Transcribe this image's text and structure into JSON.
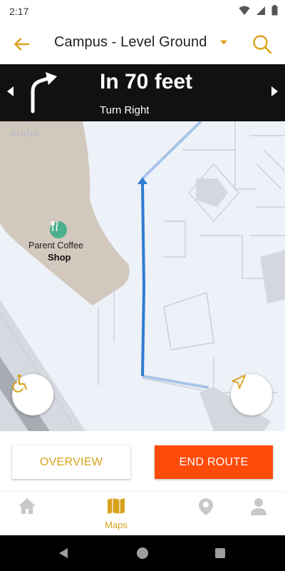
{
  "status_bar": {
    "time": "2:17"
  },
  "app_bar": {
    "title": "Campus - Level Ground"
  },
  "navigation": {
    "distance": "In 70 feet",
    "instruction": "Turn Right"
  },
  "map": {
    "logo_text": "aruba",
    "poi": {
      "name_line1": "Parent Coffee",
      "name_line2": "Shop",
      "icon": "restaurant-icon"
    }
  },
  "actions": {
    "overview_label": "OVERVIEW",
    "end_route_label": "END ROUTE"
  },
  "bottom_nav": {
    "items": [
      {
        "icon": "home-icon",
        "label": ""
      },
      {
        "icon": "map-icon",
        "label": "Maps",
        "active": true
      },
      {
        "icon": "location-pin-icon",
        "label": ""
      },
      {
        "icon": "person-icon",
        "label": ""
      }
    ]
  },
  "colors": {
    "accent": "#d8a21b",
    "end_route": "#ff4b0a",
    "route": "#2f7bd0",
    "banner": "#111111"
  }
}
